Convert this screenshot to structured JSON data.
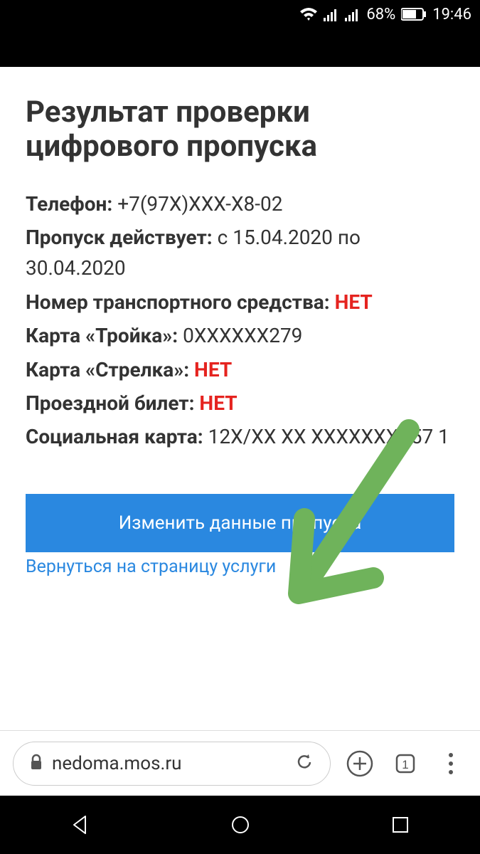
{
  "status_bar": {
    "battery_percent": "68%",
    "time": "19:46"
  },
  "page": {
    "title": "Результат проверки цифрового пропуска",
    "fields": {
      "phone_label": "Телефон:",
      "phone_value": "+7(97X)XXX-X8-02",
      "valid_label": "Пропуск действует:",
      "valid_value": "с 15.04.2020 по 30.04.2020",
      "vehicle_label": "Номер транспортного средства:",
      "vehicle_value": "НЕТ",
      "troika_label": "Карта «Тройка»:",
      "troika_value": "0XXXXXX279",
      "strelka_label": "Карта «Стрелка»:",
      "strelka_value": "НЕТ",
      "ticket_label": "Проездной билет:",
      "ticket_value": "НЕТ",
      "social_label": "Социальная карта:",
      "social_value": "12X/XX XX XXXXXXXX57 1"
    },
    "edit_button": "Изменить данные пропуска",
    "back_link": "Вернуться на страницу услуги"
  },
  "browser": {
    "url": "nedoma.mos.ru",
    "tab_count": "1"
  }
}
